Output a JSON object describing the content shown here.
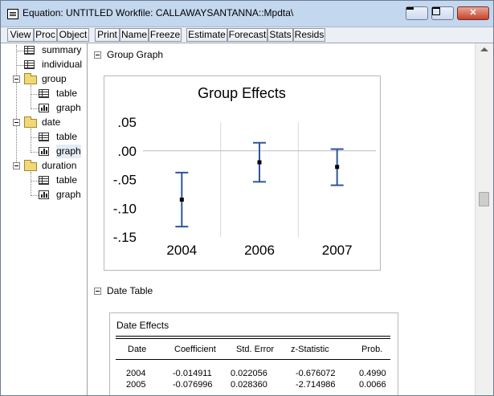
{
  "window": {
    "title": "Equation: UNTITLED   Workfile: CALLAWAYSANTANNA::Mpdta\\",
    "controls": {
      "minimize": "minimize",
      "maximize": "maximize",
      "close": "close"
    }
  },
  "toolbar": {
    "buttons": [
      "View",
      "Proc",
      "Object",
      "Print",
      "Name",
      "Freeze",
      "Estimate",
      "Forecast",
      "Stats",
      "Resids"
    ]
  },
  "tree": {
    "items": [
      {
        "label": "summary",
        "icon": "table-icon"
      },
      {
        "label": "individual",
        "icon": "table-icon"
      },
      {
        "label": "group",
        "icon": "folder-icon"
      },
      {
        "label": "table",
        "icon": "table-icon"
      },
      {
        "label": "graph",
        "icon": "graph-icon"
      },
      {
        "label": "date",
        "icon": "folder-icon"
      },
      {
        "label": "table",
        "icon": "table-icon"
      },
      {
        "label": "graph",
        "icon": "graph-icon"
      },
      {
        "label": "duration",
        "icon": "folder-icon"
      },
      {
        "label": "table",
        "icon": "table-icon"
      },
      {
        "label": "graph",
        "icon": "graph-icon"
      }
    ]
  },
  "sections": {
    "group_graph_label": "Group Graph",
    "date_table_label": "Date Table"
  },
  "chart_data": {
    "type": "errorbar",
    "title": "Group Effects",
    "categories": [
      "2004",
      "2006",
      "2007"
    ],
    "values": [
      -0.085,
      -0.02,
      -0.028
    ],
    "lower": [
      -0.132,
      -0.054,
      -0.06
    ],
    "upper": [
      -0.038,
      0.014,
      0.003
    ],
    "ylim": [
      -0.15,
      0.05
    ],
    "yticks": [
      0.05,
      0.0,
      -0.05,
      -0.1,
      -0.15
    ],
    "ytick_labels": [
      ".05",
      ".00",
      "-.05",
      "-.10",
      "-.15"
    ],
    "reference_line": 0.0,
    "grid": "vertical",
    "color": "#2f5597"
  },
  "date_table": {
    "title": "Date Effects",
    "headers": [
      "Date",
      "Coefficient",
      "Std. Error",
      "z-Statistic",
      "Prob."
    ],
    "rows": [
      [
        "2004",
        "-0.014911",
        "0.022056",
        "-0.676072",
        "0.4990"
      ],
      [
        "2005",
        "-0.076996",
        "0.028360",
        "-2.714986",
        "0.0066"
      ]
    ]
  }
}
